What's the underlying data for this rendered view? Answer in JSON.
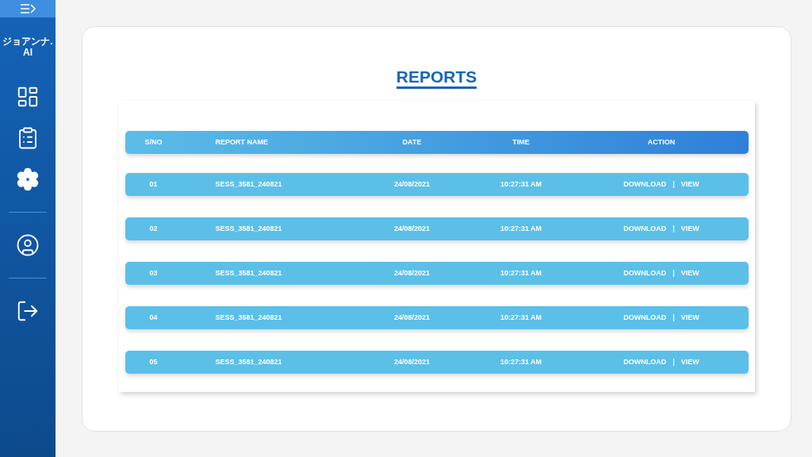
{
  "sidebar": {
    "logo": "ジョアンナ.AI",
    "items": [
      {
        "kind": "dashboard",
        "selected": false
      },
      {
        "kind": "reports",
        "selected": false
      },
      {
        "kind": "settings",
        "selected": true
      },
      {
        "kind": "divider"
      },
      {
        "kind": "profile",
        "selected": false
      },
      {
        "kind": "divider"
      },
      {
        "kind": "logout",
        "selected": false
      }
    ]
  },
  "page": {
    "title": "REPORTS"
  },
  "table": {
    "columns": [
      "S/NO",
      "REPORT NAME",
      "DATE",
      "TIME",
      "ACTION"
    ],
    "rows": [
      {
        "sno": "01",
        "name": "SESS_3581_240821",
        "date": "24/08/2021",
        "time": "10:27:31 AM",
        "actions": [
          "DOWNLOAD",
          "|",
          "VIEW"
        ]
      },
      {
        "sno": "02",
        "name": "SESS_3581_240821",
        "date": "24/08/2021",
        "time": "10:27:31 AM",
        "actions": [
          "DOWNLOAD",
          "|",
          "VIEW"
        ]
      },
      {
        "sno": "03",
        "name": "SESS_3581_240821",
        "date": "24/08/2021",
        "time": "10:27:31 AM",
        "actions": [
          "DOWNLOAD",
          "|",
          "VIEW"
        ]
      },
      {
        "sno": "04",
        "name": "SESS_3581_240821",
        "date": "24/08/2021",
        "time": "10:27:31 AM",
        "actions": [
          "DOWNLOAD",
          "|",
          "VIEW"
        ]
      },
      {
        "sno": "05",
        "name": "SESS_3581_240821",
        "date": "24/08/2021",
        "time": "10:27:31 AM",
        "actions": [
          "DOWNLOAD",
          "|",
          "VIEW"
        ]
      }
    ]
  }
}
